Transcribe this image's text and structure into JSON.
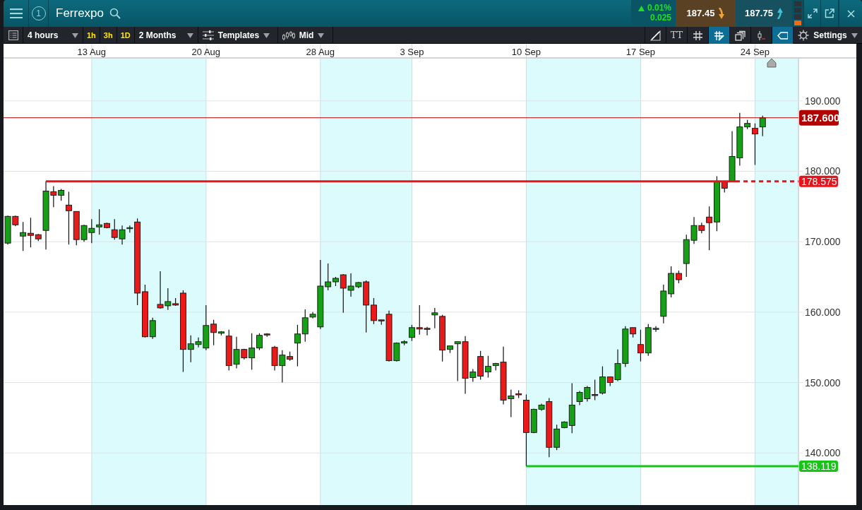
{
  "header": {
    "session_number": "1",
    "title": "Ferrexpo",
    "change": {
      "percent": "0.01%",
      "points": "0.025"
    },
    "sell": {
      "price": "187.45"
    },
    "buy": {
      "price": "187.75"
    }
  },
  "toolbar": {
    "interval": "4 hours",
    "quick_intervals": [
      "1h",
      "3h",
      "1D"
    ],
    "range": "2 Months",
    "templates": "Templates",
    "price_type": "Mid",
    "tools": [
      {
        "kind": "slope",
        "active": false
      },
      {
        "kind": "text",
        "label": "TT",
        "active": false
      },
      {
        "kind": "grid",
        "active": false
      },
      {
        "kind": "draw",
        "active": true
      },
      {
        "kind": "layers",
        "active": false
      },
      {
        "kind": "marker",
        "active": false
      },
      {
        "kind": "tag",
        "active": true
      }
    ],
    "settings": "Settings"
  },
  "chart": {
    "chart_data": {
      "type": "candlestick",
      "grid": true,
      "ylim": [
        132.6,
        196.1
      ],
      "categories": [
        null,
        null,
        null,
        null,
        null,
        null,
        null,
        null,
        null,
        null,
        null,
        "13 Aug",
        null,
        null,
        null,
        null,
        null,
        null,
        null,
        null,
        null,
        null,
        null,
        null,
        null,
        null,
        "20 Aug",
        null,
        null,
        null,
        null,
        null,
        null,
        null,
        null,
        null,
        null,
        null,
        null,
        null,
        null,
        "28 Aug",
        null,
        null,
        null,
        null,
        null,
        null,
        null,
        null,
        null,
        null,
        null,
        "3 Sep",
        null,
        null,
        null,
        null,
        null,
        null,
        null,
        null,
        null,
        null,
        null,
        null,
        null,
        null,
        "10 Sep",
        null,
        null,
        null,
        null,
        null,
        null,
        null,
        null,
        null,
        null,
        null,
        null,
        null,
        null,
        "17 Sep",
        null,
        null,
        null,
        null,
        null,
        null,
        null,
        null,
        null,
        null,
        null,
        null,
        null,
        null,
        "24 Sep",
        null
      ],
      "yticks": [
        {
          "value": 140,
          "label": "140.000"
        },
        {
          "value": 150,
          "label": "150.000"
        },
        {
          "value": 160,
          "label": "160.000"
        },
        {
          "value": 170,
          "label": "170.000"
        },
        {
          "value": 180,
          "label": "180.000"
        },
        {
          "value": 190,
          "label": "190.000"
        }
      ],
      "ohlc": [
        [
          169.8,
          173.7,
          169.6,
          173.6
        ],
        [
          173.6,
          173.7,
          172.2,
          172.4
        ],
        [
          170.8,
          172.8,
          168.7,
          171.3
        ],
        [
          171.2,
          173.4,
          169.2,
          170.9
        ],
        [
          171.0,
          171.1,
          170.1,
          170.4
        ],
        [
          171.6,
          178.6,
          168.9,
          177.2
        ],
        [
          177.1,
          177.9,
          174.9,
          176.6
        ],
        [
          176.6,
          177.5,
          175.8,
          177.3
        ],
        [
          175.2,
          177.1,
          169.6,
          174.4
        ],
        [
          174.3,
          174.3,
          169.5,
          170.3
        ],
        [
          170.3,
          172.4,
          170.0,
          172.3
        ],
        [
          171.3,
          173.2,
          169.8,
          171.9
        ],
        [
          172.1,
          174.6,
          171.0,
          172.4
        ],
        [
          172.6,
          172.7,
          171.9,
          172.0
        ],
        [
          171.7,
          173.2,
          170.3,
          170.6
        ],
        [
          170.4,
          172.3,
          169.6,
          171.7
        ],
        [
          171.9,
          172.3,
          171.3,
          172.0
        ],
        [
          172.8,
          173.3,
          161.0,
          162.7
        ],
        [
          162.9,
          163.9,
          156.4,
          156.5
        ],
        [
          156.5,
          159.2,
          156.2,
          158.8
        ],
        [
          161.1,
          165.8,
          160.5,
          160.6
        ],
        [
          160.9,
          163.4,
          160.3,
          161.5
        ],
        [
          161.2,
          162.0,
          160.9,
          161.0
        ],
        [
          162.7,
          163.1,
          151.5,
          154.7
        ],
        [
          154.7,
          156.7,
          152.9,
          155.5
        ],
        [
          155.4,
          156.4,
          155.0,
          155.8
        ],
        [
          154.9,
          161.0,
          154.6,
          158.1
        ],
        [
          158.3,
          158.9,
          155.3,
          157.1
        ],
        [
          157.0,
          157.3,
          156.7,
          157.2
        ],
        [
          156.6,
          157.5,
          151.7,
          152.4
        ],
        [
          152.6,
          156.5,
          152.0,
          154.7
        ],
        [
          154.7,
          154.8,
          153.3,
          153.5
        ],
        [
          153.5,
          157.0,
          151.8,
          154.9
        ],
        [
          154.9,
          157.0,
          154.6,
          156.7
        ],
        [
          156.9,
          157.0,
          156.5,
          156.8
        ],
        [
          155.0,
          155.2,
          151.7,
          152.4
        ],
        [
          152.4,
          154.6,
          150.0,
          153.9
        ],
        [
          153.7,
          154.4,
          153.1,
          153.3
        ],
        [
          155.6,
          158.2,
          152.3,
          156.9
        ],
        [
          156.9,
          160.4,
          155.8,
          159.2
        ],
        [
          159.3,
          160.0,
          159.1,
          159.7
        ],
        [
          157.9,
          167.4,
          157.6,
          163.7
        ],
        [
          163.6,
          166.9,
          163.1,
          164.3
        ],
        [
          164.3,
          165.0,
          163.7,
          164.8
        ],
        [
          165.3,
          165.4,
          159.9,
          163.4
        ],
        [
          163.1,
          165.5,
          162.2,
          163.7
        ],
        [
          163.6,
          164.3,
          163.4,
          164.2
        ],
        [
          164.3,
          164.5,
          157.1,
          161.0
        ],
        [
          161.0,
          162.0,
          158.3,
          158.8
        ],
        [
          158.9,
          158.9,
          158.2,
          158.8
        ],
        [
          159.7,
          160.2,
          153.0,
          153.1
        ],
        [
          153.1,
          155.7,
          153.0,
          155.6
        ],
        [
          155.6,
          156.0,
          155.3,
          155.8
        ],
        [
          156.4,
          158.2,
          155.9,
          157.8
        ],
        [
          157.8,
          161.0,
          156.8,
          157.6
        ],
        [
          157.7,
          157.9,
          156.7,
          157.6
        ],
        [
          159.6,
          160.6,
          157.7,
          159.9
        ],
        [
          159.4,
          159.6,
          153.0,
          154.6
        ],
        [
          154.7,
          155.2,
          154.2,
          155.2
        ],
        [
          155.5,
          155.8,
          150.2,
          155.8
        ],
        [
          155.8,
          156.6,
          148.4,
          150.6
        ],
        [
          150.7,
          151.9,
          150.1,
          151.5
        ],
        [
          153.7,
          154.5,
          150.4,
          150.9
        ],
        [
          151.5,
          153.8,
          150.7,
          152.3
        ],
        [
          152.4,
          152.8,
          151.7,
          152.7
        ],
        [
          152.9,
          155.1,
          146.9,
          147.5
        ],
        [
          147.7,
          149.0,
          145.1,
          148.1
        ],
        [
          148.4,
          148.9,
          147.8,
          148.3
        ],
        [
          147.5,
          148.3,
          138.1,
          142.9
        ],
        [
          142.9,
          146.3,
          142.8,
          146.2
        ],
        [
          146.2,
          147.0,
          146.0,
          146.8
        ],
        [
          147.3,
          147.8,
          139.4,
          140.8
        ],
        [
          140.8,
          144.0,
          140.4,
          143.4
        ],
        [
          143.6,
          144.5,
          143.5,
          144.4
        ],
        [
          143.9,
          149.9,
          142.8,
          146.8
        ],
        [
          147.3,
          148.8,
          146.8,
          148.6
        ],
        [
          147.7,
          149.5,
          147.3,
          149.3
        ],
        [
          148.3,
          150.4,
          147.5,
          148.2
        ],
        [
          148.5,
          152.3,
          148.3,
          150.8
        ],
        [
          150.8,
          150.8,
          149.5,
          150.0
        ],
        [
          150.4,
          154.7,
          150.2,
          152.7
        ],
        [
          152.7,
          158.0,
          152.2,
          157.6
        ],
        [
          157.8,
          157.8,
          156.4,
          156.9
        ],
        [
          155.4,
          157.5,
          153.0,
          154.2
        ],
        [
          154.2,
          158.3,
          153.8,
          157.8
        ],
        [
          157.6,
          158.0,
          157.2,
          157.7
        ],
        [
          159.4,
          163.9,
          158.4,
          163.0
        ],
        [
          162.6,
          166.5,
          162.1,
          165.5
        ],
        [
          165.5,
          165.9,
          164.1,
          164.6
        ],
        [
          166.9,
          171.0,
          165.0,
          170.3
        ],
        [
          170.2,
          173.5,
          169.7,
          172.3
        ],
        [
          172.3,
          172.7,
          171.2,
          171.6
        ],
        [
          173.5,
          175.0,
          168.8,
          172.7
        ],
        [
          172.8,
          179.3,
          171.5,
          178.5
        ],
        [
          178.5,
          178.6,
          177.0,
          177.6
        ],
        [
          178.6,
          185.7,
          178.6,
          182.1
        ],
        [
          181.9,
          188.3,
          180.8,
          186.3
        ],
        [
          186.3,
          187.3,
          186.0,
          186.8
        ],
        [
          186.1,
          186.8,
          180.9,
          185.3
        ],
        [
          186.3,
          187.9,
          185.0,
          187.6
        ]
      ],
      "ref_lines": [
        {
          "axis": "y",
          "value": 187.6,
          "label": "187.600",
          "color": "#b30000"
        },
        {
          "axis": "y",
          "value": 178.575,
          "label": "178.575",
          "color": "#e8141c"
        },
        {
          "axis": "y",
          "value": 138.119,
          "label": "138.119",
          "color": "#19c419"
        }
      ]
    }
  }
}
